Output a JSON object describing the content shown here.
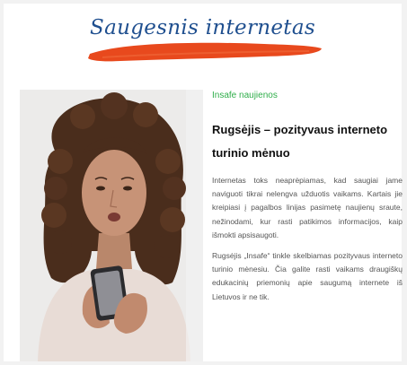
{
  "header": {
    "title": "Saugesnis internetas",
    "accent_color": "#e8491d",
    "title_color": "#1f4f8f"
  },
  "photo": {
    "description_icon": "photo-icon"
  },
  "article": {
    "category": "Insafe naujienos",
    "category_color": "#2fae4a",
    "headline": "Rugsėjis – pozityvaus interneto turinio mėnuo",
    "paragraphs": [
      "Internetas toks neaprėpiamas, kad saugiai jame naviguoti tikrai nelengva užduotis vaikams. Kartais jie kreipiasi į pagalbos linijas pasimetę naujienų sraute, nežinodami, kur rasti patikimos informacijos, kaip išmokti apsisaugoti.",
      "Rugsėjis „Insafe“ tinkle skelbiamas pozityvaus interneto turinio mėnesiu. Čia galite rasti vaikams draugiškų edukacinių priemonių apie saugumą internete iš Lietuvos ir ne tik."
    ]
  }
}
